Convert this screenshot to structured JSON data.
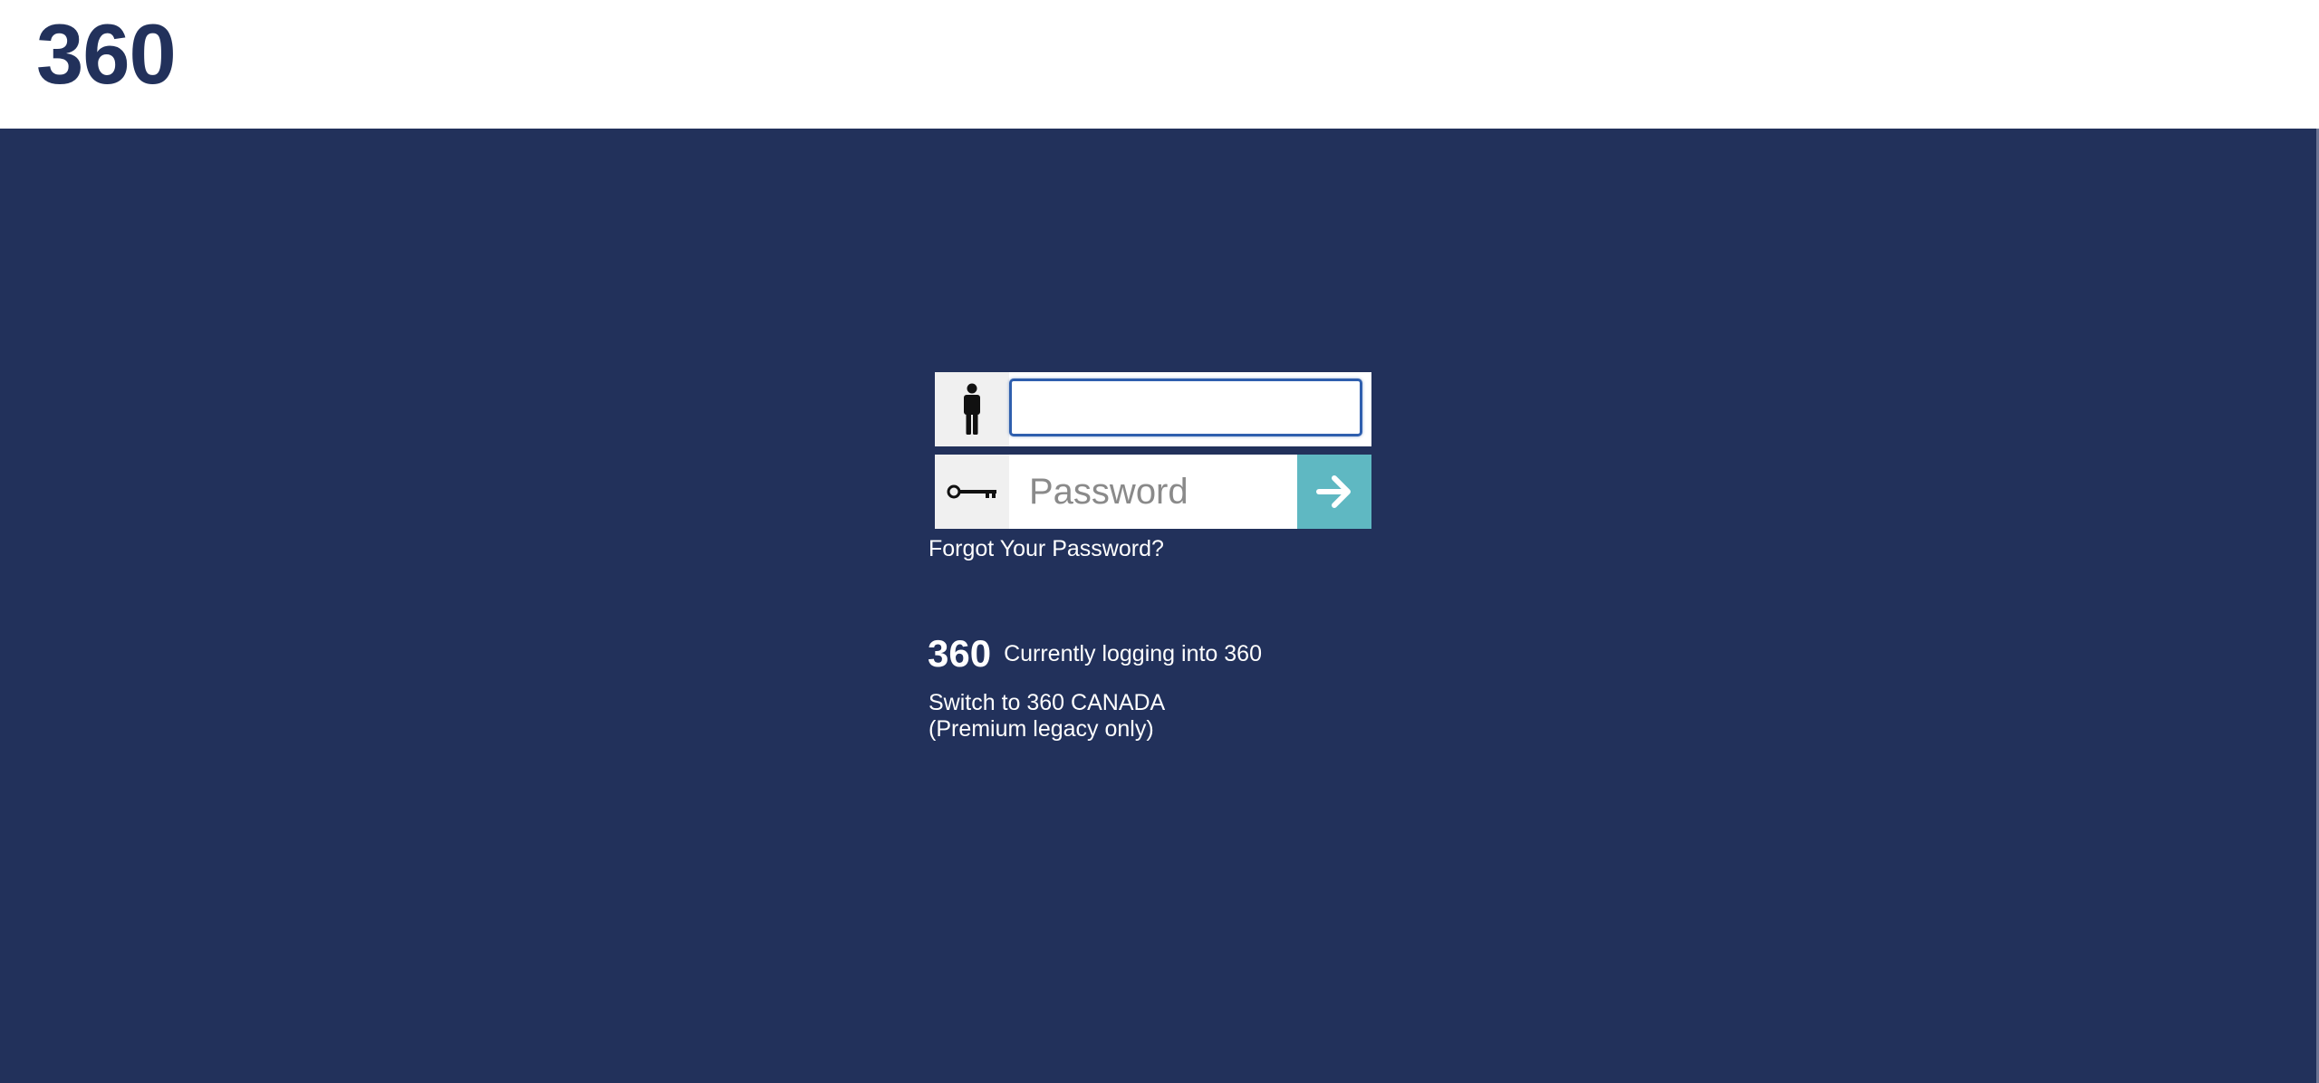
{
  "header": {
    "logo_text": "360"
  },
  "login": {
    "username": {
      "value": "",
      "placeholder": "",
      "icon": "person-icon"
    },
    "password": {
      "value": "",
      "placeholder": "Password",
      "icon": "key-icon"
    },
    "submit_icon": "arrow-right-icon",
    "forgot_link": "Forgot Your Password?"
  },
  "region": {
    "logo_text": "360",
    "status": "Currently logging into 360",
    "switch_line1": "Switch to 360 CANADA",
    "switch_line2": "(Premium legacy only)"
  },
  "colors": {
    "background": "#22315b",
    "header_bg": "#ffffff",
    "brand_text": "#22315b",
    "submit_bg": "#5fb8c2",
    "focus_border": "#2f5fae"
  }
}
